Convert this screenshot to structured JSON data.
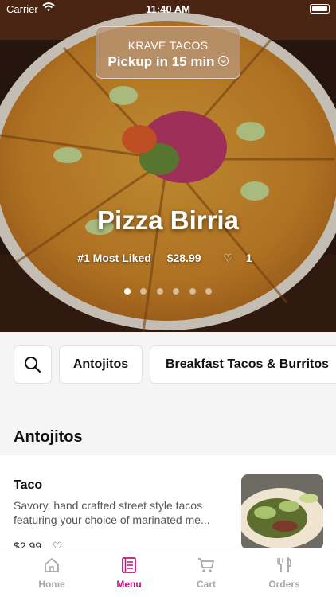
{
  "status_bar": {
    "carrier": "Carrier",
    "time": "11:40 AM"
  },
  "store": {
    "name": "KRAVE TACOS",
    "pickup_text": "Pickup in 15 min"
  },
  "featured": {
    "title": "Pizza Birria",
    "rank": "#1 Most Liked",
    "price": "$28.99",
    "likes": "1",
    "carousel_count": 6,
    "carousel_active": 1
  },
  "categories": {
    "search_icon": "search-icon",
    "items": [
      "Antojitos",
      "Breakfast Tacos & Burritos"
    ]
  },
  "section": {
    "title": "Antojitos"
  },
  "menu_items": [
    {
      "name": "Taco",
      "description": "Savory, hand crafted street style tacos featuring your choice of marinated me...",
      "price": "$2.99"
    }
  ],
  "tab_bar": {
    "tabs": [
      {
        "label": "Home",
        "icon": "home-icon"
      },
      {
        "label": "Menu",
        "icon": "menu-icon"
      },
      {
        "label": "Cart",
        "icon": "cart-icon"
      },
      {
        "label": "Orders",
        "icon": "orders-icon"
      }
    ],
    "active_index": 1
  },
  "colors": {
    "accent": "#c2127c",
    "inactive": "#a8a8a8"
  }
}
